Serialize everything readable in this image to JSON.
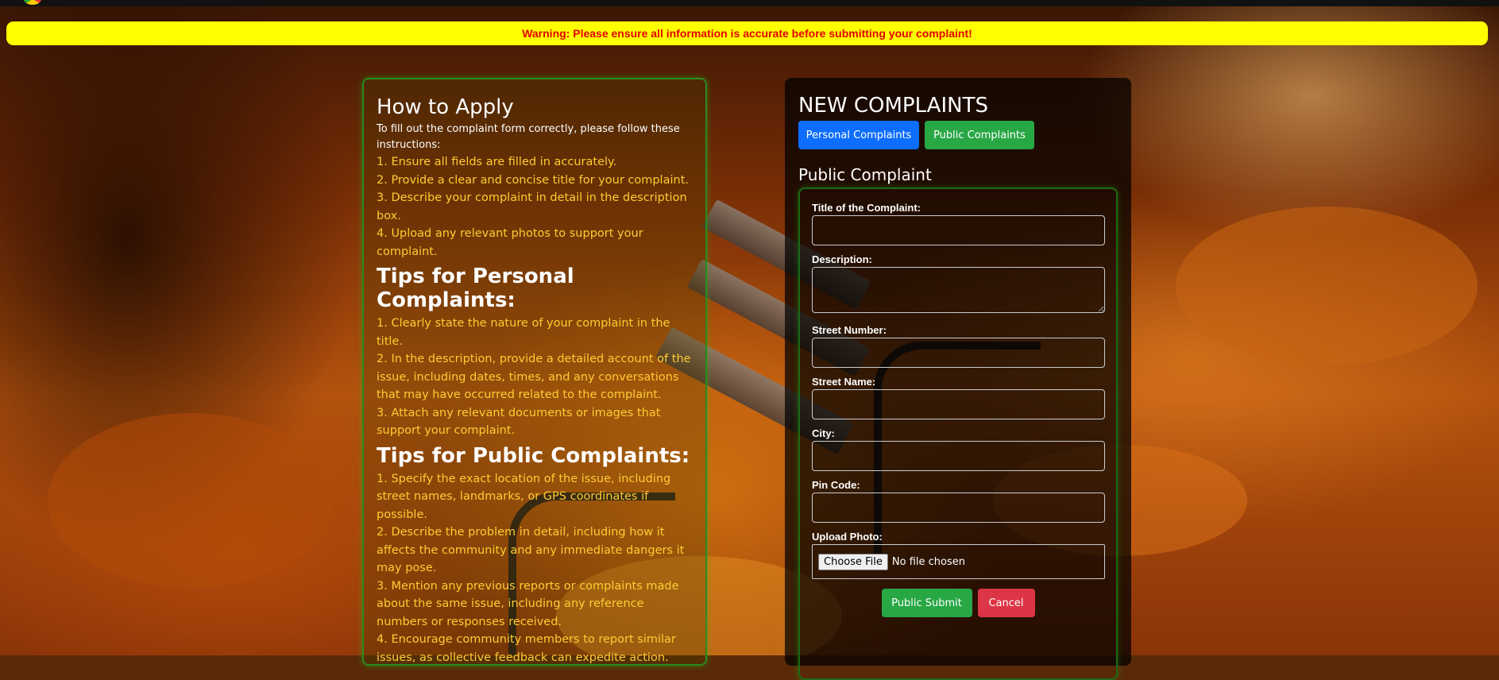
{
  "warning": {
    "text": "Warning: Please ensure all information is accurate before submitting your complaint!"
  },
  "guide": {
    "title": "How to Apply",
    "intro": "To fill out the complaint form correctly, please follow these instructions:",
    "steps": [
      "1. Ensure all fields are filled in accurately.",
      "2. Provide a clear and concise title for your complaint.",
      "3. Describe your complaint in detail in the description box.",
      "4. Upload any relevant photos to support your complaint."
    ],
    "personal_title": "Tips for Personal Complaints:",
    "personal_tips": [
      "1. Clearly state the nature of your complaint in the title.",
      "2. In the description, provide a detailed account of the issue, including dates, times, and any conversations that may have occurred related to the complaint.",
      "3. Attach any relevant documents or images that support your complaint."
    ],
    "public_title": "Tips for Public Complaints:",
    "public_tips": [
      "1. Specify the exact location of the issue, including street names, landmarks, or GPS coordinates if possible.",
      "2. Describe the problem in detail, including how it affects the community and any immediate dangers it may pose.",
      "3. Mention any previous reports or complaints made about the same issue, including any reference numbers or responses received.",
      "4. Encourage community members to report similar issues, as collective feedback can expedite action."
    ]
  },
  "complaints": {
    "title": "NEW COMPLAINTS",
    "personal_button": "Personal Complaints",
    "public_button": "Public Complaints",
    "form_title": "Public Complaint",
    "fields": {
      "title_label": "Title of the Complaint:",
      "description_label": "Description:",
      "street_number_label": "Street Number:",
      "street_name_label": "Street Name:",
      "city_label": "City:",
      "pin_code_label": "Pin Code:",
      "upload_label": "Upload Photo:"
    },
    "file_button": "Choose File",
    "file_status": "No file chosen",
    "submit_button": "Public Submit",
    "cancel_button": "Cancel"
  },
  "colors": {
    "warning_bg": "#ffff00",
    "warning_text": "#e10000",
    "tip_text": "#ffcc33",
    "primary": "#0d6efd",
    "success": "#28a745",
    "danger": "#dc3545"
  }
}
